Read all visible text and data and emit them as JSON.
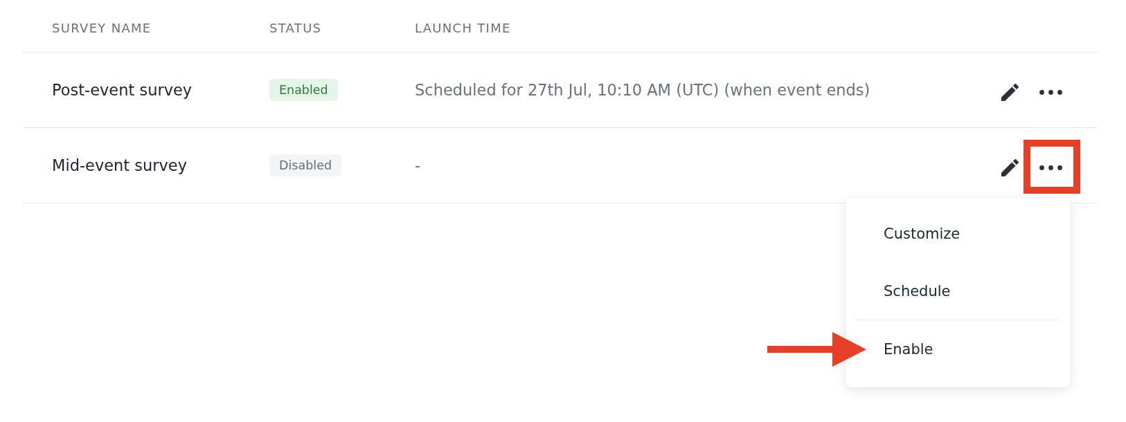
{
  "table": {
    "columns": [
      "SURVEY NAME",
      "STATUS",
      "LAUNCH TIME"
    ],
    "rows": [
      {
        "name": "Post-event survey",
        "status": {
          "label": "Enabled",
          "kind": "enabled"
        },
        "launch_time": "Scheduled for 27th Jul, 10:10 AM (UTC) (when event ends)",
        "highlighted": false
      },
      {
        "name": "Mid-event survey",
        "status": {
          "label": "Disabled",
          "kind": "disabled"
        },
        "launch_time": "-",
        "highlighted": true,
        "menu": {
          "groups": [
            {
              "items": [
                {
                  "label": "Customize",
                  "pointed": false
                },
                {
                  "label": "Schedule",
                  "pointed": false
                }
              ]
            },
            {
              "items": [
                {
                  "label": "Enable",
                  "pointed": true
                }
              ]
            }
          ]
        }
      }
    ]
  }
}
